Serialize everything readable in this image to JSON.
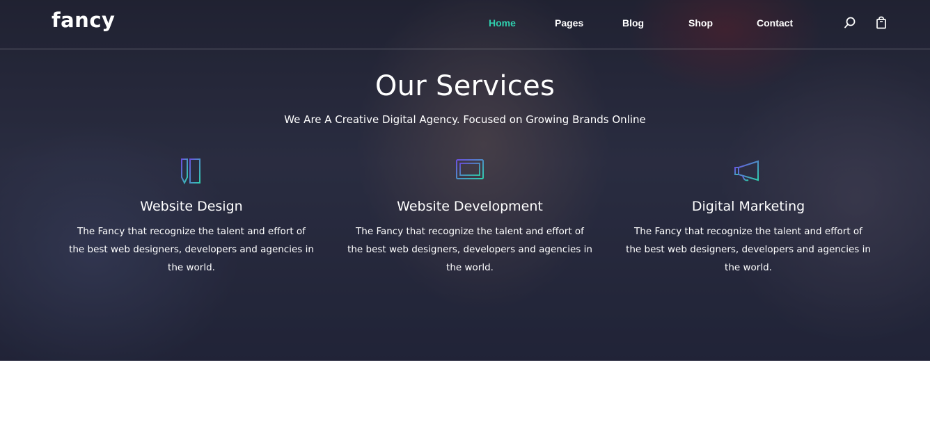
{
  "brand": {
    "logo": "fancy",
    "accent_color": "#2fcfae"
  },
  "nav": {
    "items": [
      {
        "label": "Home",
        "active": true
      },
      {
        "label": "Pages",
        "active": false
      },
      {
        "label": "Blog",
        "active": false
      },
      {
        "label": "Shop",
        "active": false
      },
      {
        "label": "Contact",
        "active": false
      }
    ],
    "icons": [
      "search-icon",
      "shopping-bag-icon"
    ]
  },
  "hero": {
    "title": "Our Services",
    "subtitle": "We Are A Creative Digital Agency. Focused on Growing Brands Online"
  },
  "services": [
    {
      "icon": "pencil-ruler-icon",
      "title": "Website Design",
      "text": "The Fancy that recognize the talent and effort of the best web designers, developers and agencies in the world."
    },
    {
      "icon": "monitor-icon",
      "title": "Website Development",
      "text": "The Fancy that recognize the talent and effort of the best web designers, developers and agencies in the world."
    },
    {
      "icon": "megaphone-icon",
      "title": "Digital Marketing",
      "text": "The Fancy that recognize the talent and effort of the best web designers, developers and agencies in the world."
    }
  ]
}
